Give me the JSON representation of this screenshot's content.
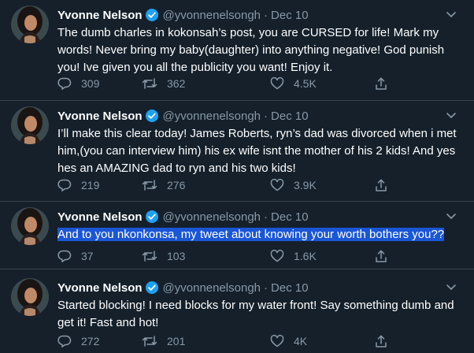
{
  "tweets": [
    {
      "name": "Yvonne Nelson",
      "handle": "@yvonnenelsongh",
      "dot": "·",
      "date": "Dec 10",
      "text": "The dumb charles in kokonsah’s post, you are CURSED for life! Mark my words! Never bring my baby(daughter) into anything negative! God punish you! Ive given you all the publicity you want! Enjoy it.",
      "replies": "309",
      "retweets": "362",
      "likes": "4.5K",
      "highlighted": false
    },
    {
      "name": "Yvonne Nelson",
      "handle": "@yvonnenelsongh",
      "dot": "·",
      "date": "Dec 10",
      "text": "I’ll make this clear today! James Roberts, ryn’s dad was divorced when i met him,(you can interview him) his ex wife isnt the mother of his 2 kids! And yes hes an AMAZING dad to ryn and his two kids!",
      "replies": "219",
      "retweets": "276",
      "likes": "3.9K",
      "highlighted": false
    },
    {
      "name": "Yvonne Nelson",
      "handle": "@yvonnenelsongh",
      "dot": "·",
      "date": "Dec 10",
      "text": "And to you nkonkonsa, my tweet about knowing your worth bothers you??",
      "replies": "37",
      "retweets": "103",
      "likes": "1.6K",
      "highlighted": true
    },
    {
      "name": "Yvonne Nelson",
      "handle": "@yvonnenelsongh",
      "dot": "·",
      "date": "Dec 10",
      "text": "Started blocking! I need blocks for my water front! Say something dumb and get it! Fast and hot!",
      "replies": "272",
      "retweets": "201",
      "likes": "4K",
      "highlighted": false
    }
  ],
  "icons": {
    "verified": "verified-badge-icon",
    "caret": "chevron-down-icon",
    "reply": "reply-icon",
    "retweet": "retweet-icon",
    "like": "heart-icon",
    "share": "share-icon"
  },
  "colors": {
    "background": "#15202b",
    "divider": "#38444d",
    "secondary_text": "#8899a6",
    "verified": "#1da1f2",
    "selection": "#1a56d6"
  }
}
